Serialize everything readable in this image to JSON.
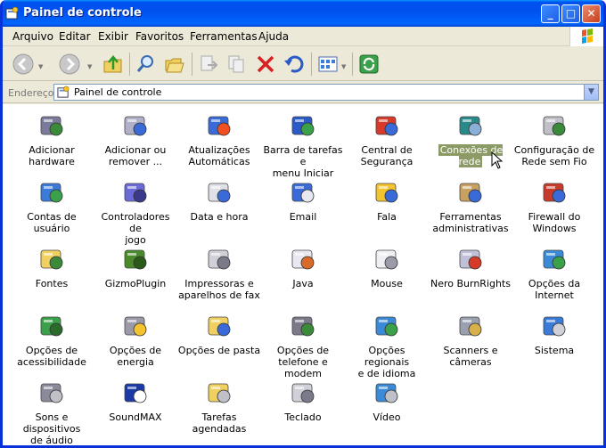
{
  "window": {
    "title": "Painel de controle"
  },
  "menu": [
    "Arquivo",
    "Editar",
    "Exibir",
    "Favoritos",
    "Ferramentas",
    "Ajuda"
  ],
  "address": {
    "label": "Endereço",
    "value": "Painel de controle"
  },
  "items": [
    {
      "label1": "Adicionar",
      "label2": "hardware",
      "icon": "hardware-icon"
    },
    {
      "label1": "Adicionar ou",
      "label2": "remover ...",
      "icon": "add-remove-icon"
    },
    {
      "label1": "Atualizações",
      "label2": "Automáticas",
      "icon": "windows-update-icon"
    },
    {
      "label1": "Barra de tarefas e",
      "label2": "menu Iniciar",
      "icon": "taskbar-icon"
    },
    {
      "label1": "Central de",
      "label2": "Segurança",
      "icon": "security-shield-icon"
    },
    {
      "label1": "Conexões de rede",
      "label2": "",
      "icon": "network-globe-icon",
      "selected": true
    },
    {
      "label1": "Configuração de",
      "label2": "Rede sem Fio",
      "icon": "wireless-icon"
    },
    {
      "label1": "Contas de usuário",
      "label2": "",
      "icon": "users-icon"
    },
    {
      "label1": "Controladores de",
      "label2": "jogo",
      "icon": "gamepad-icon"
    },
    {
      "label1": "Data e hora",
      "label2": "",
      "icon": "clock-icon"
    },
    {
      "label1": "Email",
      "label2": "",
      "icon": "email-icon"
    },
    {
      "label1": "Fala",
      "label2": "",
      "icon": "speech-icon"
    },
    {
      "label1": "Ferramentas",
      "label2": "administrativas",
      "icon": "admin-tools-icon"
    },
    {
      "label1": "Firewall do",
      "label2": "Windows",
      "icon": "firewall-icon"
    },
    {
      "label1": "Fontes",
      "label2": "",
      "icon": "fonts-folder-icon"
    },
    {
      "label1": "GizmoPlugin",
      "label2": "",
      "icon": "gizmo-icon"
    },
    {
      "label1": "Impressoras e",
      "label2": "aparelhos de fax",
      "icon": "printer-icon"
    },
    {
      "label1": "Java",
      "label2": "",
      "icon": "java-icon"
    },
    {
      "label1": "Mouse",
      "label2": "",
      "icon": "mouse-icon"
    },
    {
      "label1": "Nero BurnRights",
      "label2": "",
      "icon": "nero-icon"
    },
    {
      "label1": "Opções da",
      "label2": "Internet",
      "icon": "internet-options-icon"
    },
    {
      "label1": "Opções de",
      "label2": "acessibilidade",
      "icon": "accessibility-icon"
    },
    {
      "label1": "Opções de energia",
      "label2": "",
      "icon": "power-icon"
    },
    {
      "label1": "Opções de pasta",
      "label2": "",
      "icon": "folder-options-icon"
    },
    {
      "label1": "Opções de",
      "label2": "telefone e modem",
      "icon": "phone-modem-icon"
    },
    {
      "label1": "Opções regionais",
      "label2": "e de idioma",
      "icon": "regional-icon"
    },
    {
      "label1": "Scanners e",
      "label2": "câmeras",
      "icon": "scanner-icon"
    },
    {
      "label1": "Sistema",
      "label2": "",
      "icon": "system-icon"
    },
    {
      "label1": "Sons e dispositivos",
      "label2": "de áudio",
      "icon": "sound-icon"
    },
    {
      "label1": "SoundMAX",
      "label2": "",
      "icon": "soundmax-icon"
    },
    {
      "label1": "Tarefas",
      "label2": "agendadas",
      "icon": "scheduled-tasks-icon"
    },
    {
      "label1": "Teclado",
      "label2": "",
      "icon": "keyboard-icon"
    },
    {
      "label1": "Vídeo",
      "label2": "",
      "icon": "video-icon"
    }
  ]
}
